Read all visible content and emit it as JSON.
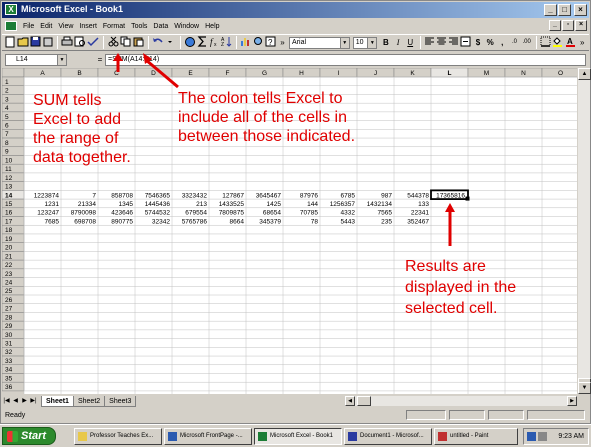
{
  "window": {
    "title": "Microsoft Excel - Book1",
    "min_glyph": "_",
    "max_glyph": "□",
    "close_glyph": "×"
  },
  "menus": [
    "File",
    "Edit",
    "View",
    "Insert",
    "Format",
    "Tools",
    "Data",
    "Window",
    "Help"
  ],
  "doc_controls": {
    "min_glyph": "_",
    "restore_glyph": "▫",
    "close_glyph": "×"
  },
  "toolbar": {
    "font_name": "Arial",
    "font_size": "10",
    "zoom_glyph": "»"
  },
  "formula_bar": {
    "name_box": "L14",
    "equals": "=",
    "formula": "=SUM(A14:K14)"
  },
  "sheet": {
    "columns": [
      "A",
      "B",
      "C",
      "D",
      "E",
      "F",
      "G",
      "H",
      "I",
      "J",
      "K",
      "L",
      "M",
      "N",
      "O"
    ],
    "row_count": 36,
    "active_cell": "L14",
    "active_value": "17365816",
    "data_rows": [
      {
        "row": 14,
        "cells": [
          "1223874",
          "7",
          "858708",
          "7546365",
          "3323432",
          "127867",
          "3645467",
          "87976",
          "6785",
          "987",
          "544378"
        ]
      },
      {
        "row": 15,
        "cells": [
          "1231",
          "21334",
          "1345",
          "1445436",
          "213",
          "1433525",
          "1425",
          "144",
          "1256357",
          "1432134",
          "133"
        ]
      },
      {
        "row": 16,
        "cells": [
          "123247",
          "8790098",
          "423646",
          "5744532",
          "679554",
          "7809875",
          "68654",
          "70785",
          "4332",
          "7565",
          "22341"
        ]
      },
      {
        "row": 17,
        "cells": [
          "7685",
          "698708",
          "890775",
          "32342",
          "5765786",
          "8664",
          "345379",
          "78",
          "5443",
          "235",
          "352467"
        ]
      }
    ]
  },
  "sheet_tabs": [
    "Sheet1",
    "Sheet2",
    "Sheet3"
  ],
  "status": {
    "text": "Ready"
  },
  "annotations": {
    "sum_lines": [
      "SUM tells",
      "Excel to add",
      "the range of",
      "data together."
    ],
    "colon_lines": [
      "The colon tells Excel to",
      "include all of the cells in",
      "between those indicated."
    ],
    "result_lines": [
      "Results are",
      "displayed in the",
      "selected cell."
    ],
    "color": "#e00000"
  },
  "taskbar": {
    "start_label": "Start",
    "tasks": [
      "Professor Teaches Ex...",
      "Microsoft FrontPage -...",
      "Microsoft Excel - Book1",
      "Document1 - Microsof...",
      "untitled - Paint"
    ],
    "active_task": "Microsoft Excel - Book1",
    "clock": "9:23 AM"
  },
  "colors": {
    "title_start": "#0a246a",
    "title_end": "#a6caf0",
    "face": "#d4d0c8",
    "annotation": "#e00000"
  }
}
